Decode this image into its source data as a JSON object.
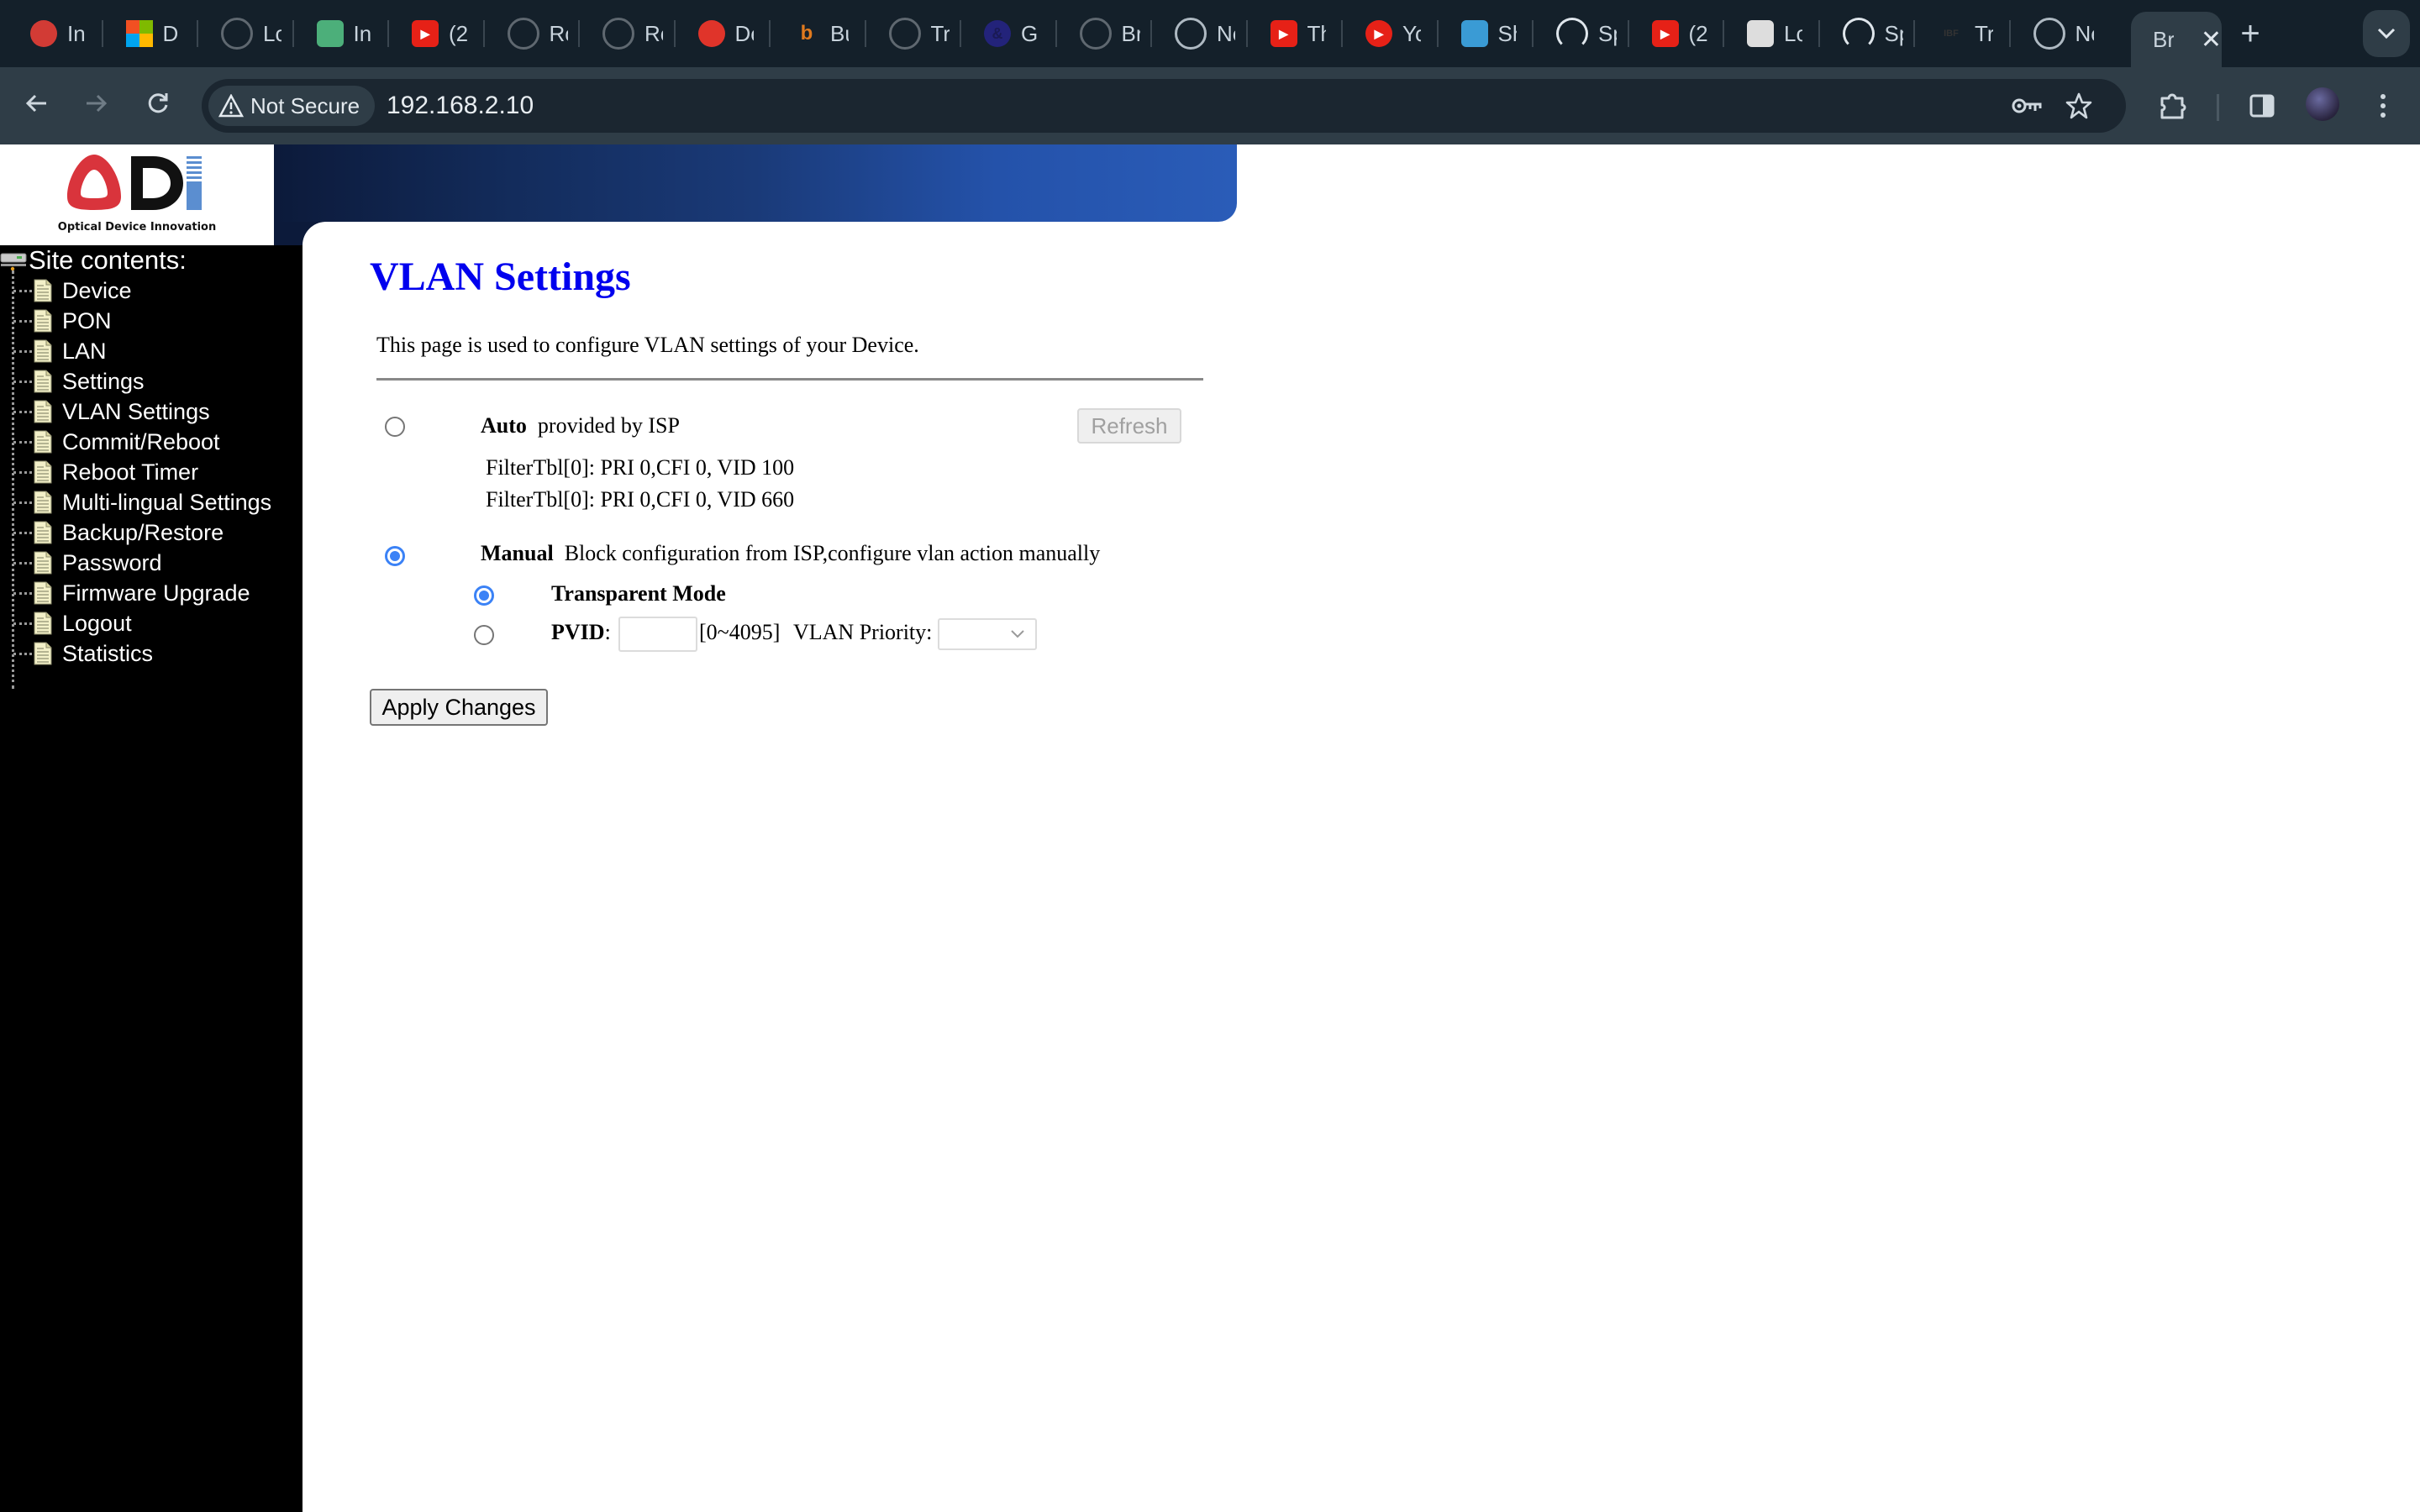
{
  "browser": {
    "tabs": [
      {
        "title": "In",
        "icon": "speedometer-icon",
        "color": "#d23b35"
      },
      {
        "title": "D",
        "icon": "microsoft-icon",
        "color": "#f25022"
      },
      {
        "title": "Lo",
        "icon": "globe-icon",
        "color": "#5f6870"
      },
      {
        "title": "In",
        "icon": "app-icon",
        "color": "#4caf7a"
      },
      {
        "title": "(2",
        "icon": "youtube-icon",
        "color": "#e62117"
      },
      {
        "title": "Ro",
        "icon": "globe-icon",
        "color": "#5f6870"
      },
      {
        "title": "Ro",
        "icon": "globe-icon",
        "color": "#5f6870"
      },
      {
        "title": "De",
        "icon": "helmet-icon",
        "color": "#e0342a"
      },
      {
        "title": "Bu",
        "icon": "b-icon",
        "color": "#e07a1e"
      },
      {
        "title": "Tr",
        "icon": "globe-icon",
        "color": "#5f6870"
      },
      {
        "title": "Gl",
        "icon": "ampersand-icon",
        "color": "#23237a"
      },
      {
        "title": "Br",
        "icon": "globe-icon",
        "color": "#5f6870"
      },
      {
        "title": "Ne",
        "icon": "chrome-icon",
        "color": "#aeb9c2"
      },
      {
        "title": "Th",
        "icon": "youtube-icon",
        "color": "#e62117"
      },
      {
        "title": "Yo",
        "icon": "youtube-music-icon",
        "color": "#e62117"
      },
      {
        "title": "Sh",
        "icon": "box-icon",
        "color": "#3a9bd5"
      },
      {
        "title": "Sp",
        "icon": "speedtest-icon",
        "color": "#14202a"
      },
      {
        "title": "(2",
        "icon": "youtube-icon",
        "color": "#e62117"
      },
      {
        "title": "Lo",
        "icon": "camera-icon",
        "color": "#dddddd"
      },
      {
        "title": "Sp",
        "icon": "speedtest-icon",
        "color": "#14202a"
      },
      {
        "title": "Tr",
        "icon": "ibf-icon",
        "color": "#333333"
      },
      {
        "title": "Ne",
        "icon": "chrome-icon",
        "color": "#aeb9c2"
      }
    ],
    "active_tab": {
      "title": "Br"
    },
    "security_label": "Not Secure",
    "url": "192.168.2.10"
  },
  "logo": {
    "brand": "ODI",
    "tagline": "Optical Device Innovation"
  },
  "sidebar": {
    "title": "Site contents:",
    "items": [
      {
        "label": "Device"
      },
      {
        "label": "PON"
      },
      {
        "label": "LAN"
      },
      {
        "label": "Settings"
      },
      {
        "label": "VLAN Settings"
      },
      {
        "label": "Commit/Reboot"
      },
      {
        "label": "Reboot Timer"
      },
      {
        "label": "Multi-lingual Settings"
      },
      {
        "label": "Backup/Restore"
      },
      {
        "label": "Password"
      },
      {
        "label": "Firmware Upgrade"
      },
      {
        "label": "Logout"
      },
      {
        "label": "Statistics"
      }
    ]
  },
  "main": {
    "title": "VLAN Settings",
    "description": "This page is used to configure VLAN settings of your Device.",
    "auto": {
      "label": "Auto",
      "desc": "provided by ISP",
      "selected": false,
      "refresh_label": "Refresh",
      "filters": [
        "FilterTbl[0]: PRI 0,CFI 0, VID 100",
        "FilterTbl[0]: PRI 0,CFI 0, VID 660"
      ]
    },
    "manual": {
      "label": "Manual",
      "desc": "Block configuration from ISP,configure vlan action manually",
      "selected": true,
      "transparent_label": "Transparent Mode",
      "transparent_selected": true,
      "pvid_label": "PVID",
      "pvid_value": "",
      "pvid_range": "[0~4095]",
      "priority_label": "VLAN Priority:",
      "priority_value": ""
    },
    "apply_label": "Apply Changes"
  }
}
